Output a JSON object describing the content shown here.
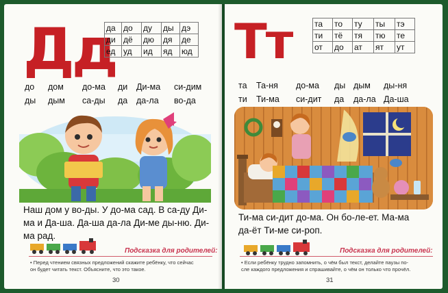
{
  "left_page": {
    "letter": "Дд",
    "syllables": [
      [
        "да",
        "до",
        "ду",
        "ды",
        "дэ"
      ],
      [
        "ди",
        "дё",
        "дю",
        "дя",
        "де"
      ],
      [
        "ед",
        "уд",
        "ид",
        "яд",
        "юд"
      ]
    ],
    "word_rows": [
      [
        "до",
        "дом",
        "до-ма",
        "ди",
        "Ди-ма",
        "си-дим"
      ],
      [
        "ды",
        "дым",
        "са-ды",
        "да",
        "да-ла",
        "во-да"
      ]
    ],
    "sentences": [
      "Наш дом у во-ды. У до-ма сад. В са-ду Ди-",
      "ма и Да-ша. Да-ша да-ла Ди-ме ды-ню. Ди-",
      "ма рад."
    ],
    "hint_title": "Подсказка для родителей:",
    "hint_text": [
      "•  Перед чтением связных предложений скажите ребёнку, что сейчас",
      "он будет читать текст. Объясните, что это такое."
    ],
    "page_number": "30"
  },
  "right_page": {
    "letter": "Тт",
    "syllables": [
      [
        "та",
        "то",
        "ту",
        "ты",
        "тэ"
      ],
      [
        "ти",
        "тё",
        "тя",
        "тю",
        "те"
      ],
      [
        "от",
        "до",
        "ат",
        "ят",
        "ут"
      ]
    ],
    "word_rows": [
      [
        "та",
        "Та-ня",
        "до-ма",
        "ды",
        "дым",
        "ды-ня"
      ],
      [
        "ти",
        "Ти-ма",
        "си-дит",
        "да",
        "да-ла",
        "Да-ша"
      ]
    ],
    "sentences": [
      "Ти-ма си-дит до-ма. Он бо-ле-ет. Ма-ма",
      "да-ёт Ти-ме си-роп."
    ],
    "hint_title": "Подсказка для родителей:",
    "hint_text": [
      "•  Если ребёнку трудно запомнить, о чём был текст, делайте паузы по-",
      "сле каждого предложения и спрашивайте, о чём он только что прочёл."
    ],
    "page_number": "31"
  },
  "colors": {
    "letter": "#c62025",
    "hint": "#c8334e",
    "cover": "#1d5a2c"
  },
  "icons": [
    "train-icon"
  ]
}
